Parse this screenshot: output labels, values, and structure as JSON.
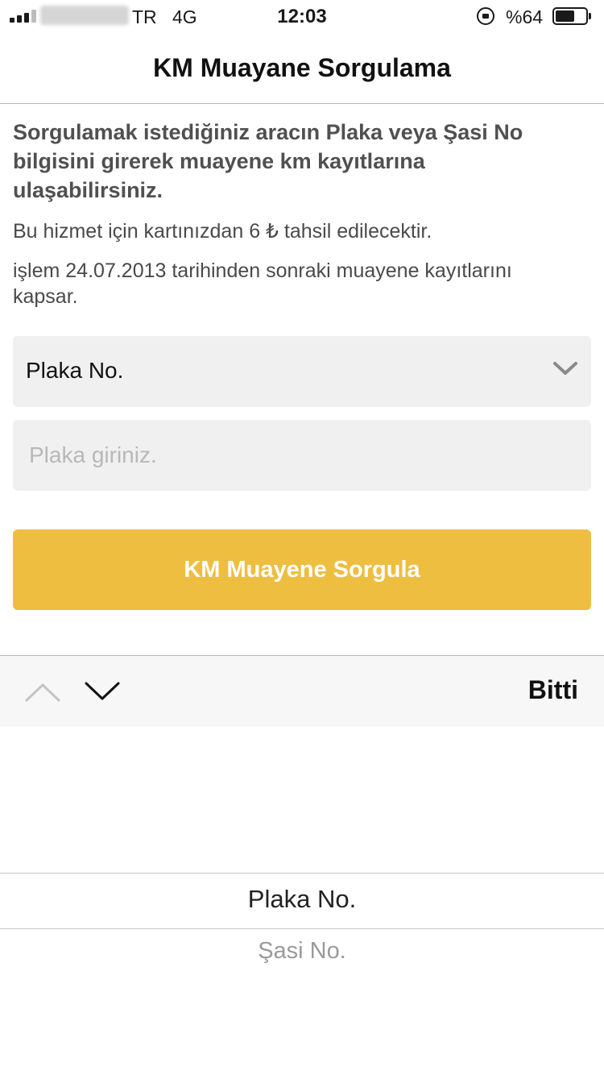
{
  "status_bar": {
    "carrier": "TR",
    "network": "4G",
    "time": "12:03",
    "battery_text": "%64",
    "battery_level": 0.64
  },
  "nav": {
    "title": "KM Muayane Sorgulama"
  },
  "content": {
    "intro": "Sorgulamak istediğiniz aracın Plaka veya Şasi No bilgisini girerek muayene km kayıtlarına ulaşabilirsiniz.",
    "fee_note": "Bu hizmet için kartınızdan 6 ₺ tahsil edilecektir.",
    "date_note": "işlem 24.07.2013 tarihinden sonraki muayene kayıtlarını kapsar."
  },
  "form": {
    "select_value": "Plaka No.",
    "input_value": "",
    "input_placeholder": "Plaka giriniz.",
    "submit_label": "KM Muayene Sorgula"
  },
  "toolbar": {
    "done_label": "Bitti"
  },
  "picker": {
    "options": [
      "Plaka No.",
      "Şasi No."
    ],
    "selected_index": 0
  },
  "colors": {
    "accent": "#edbe40",
    "field_bg": "#f0f0f0",
    "text_muted": "#505050"
  },
  "icons": {
    "select_chevron": "chevron-down-icon",
    "prev": "chevron-up-icon",
    "next": "chevron-down-icon"
  }
}
